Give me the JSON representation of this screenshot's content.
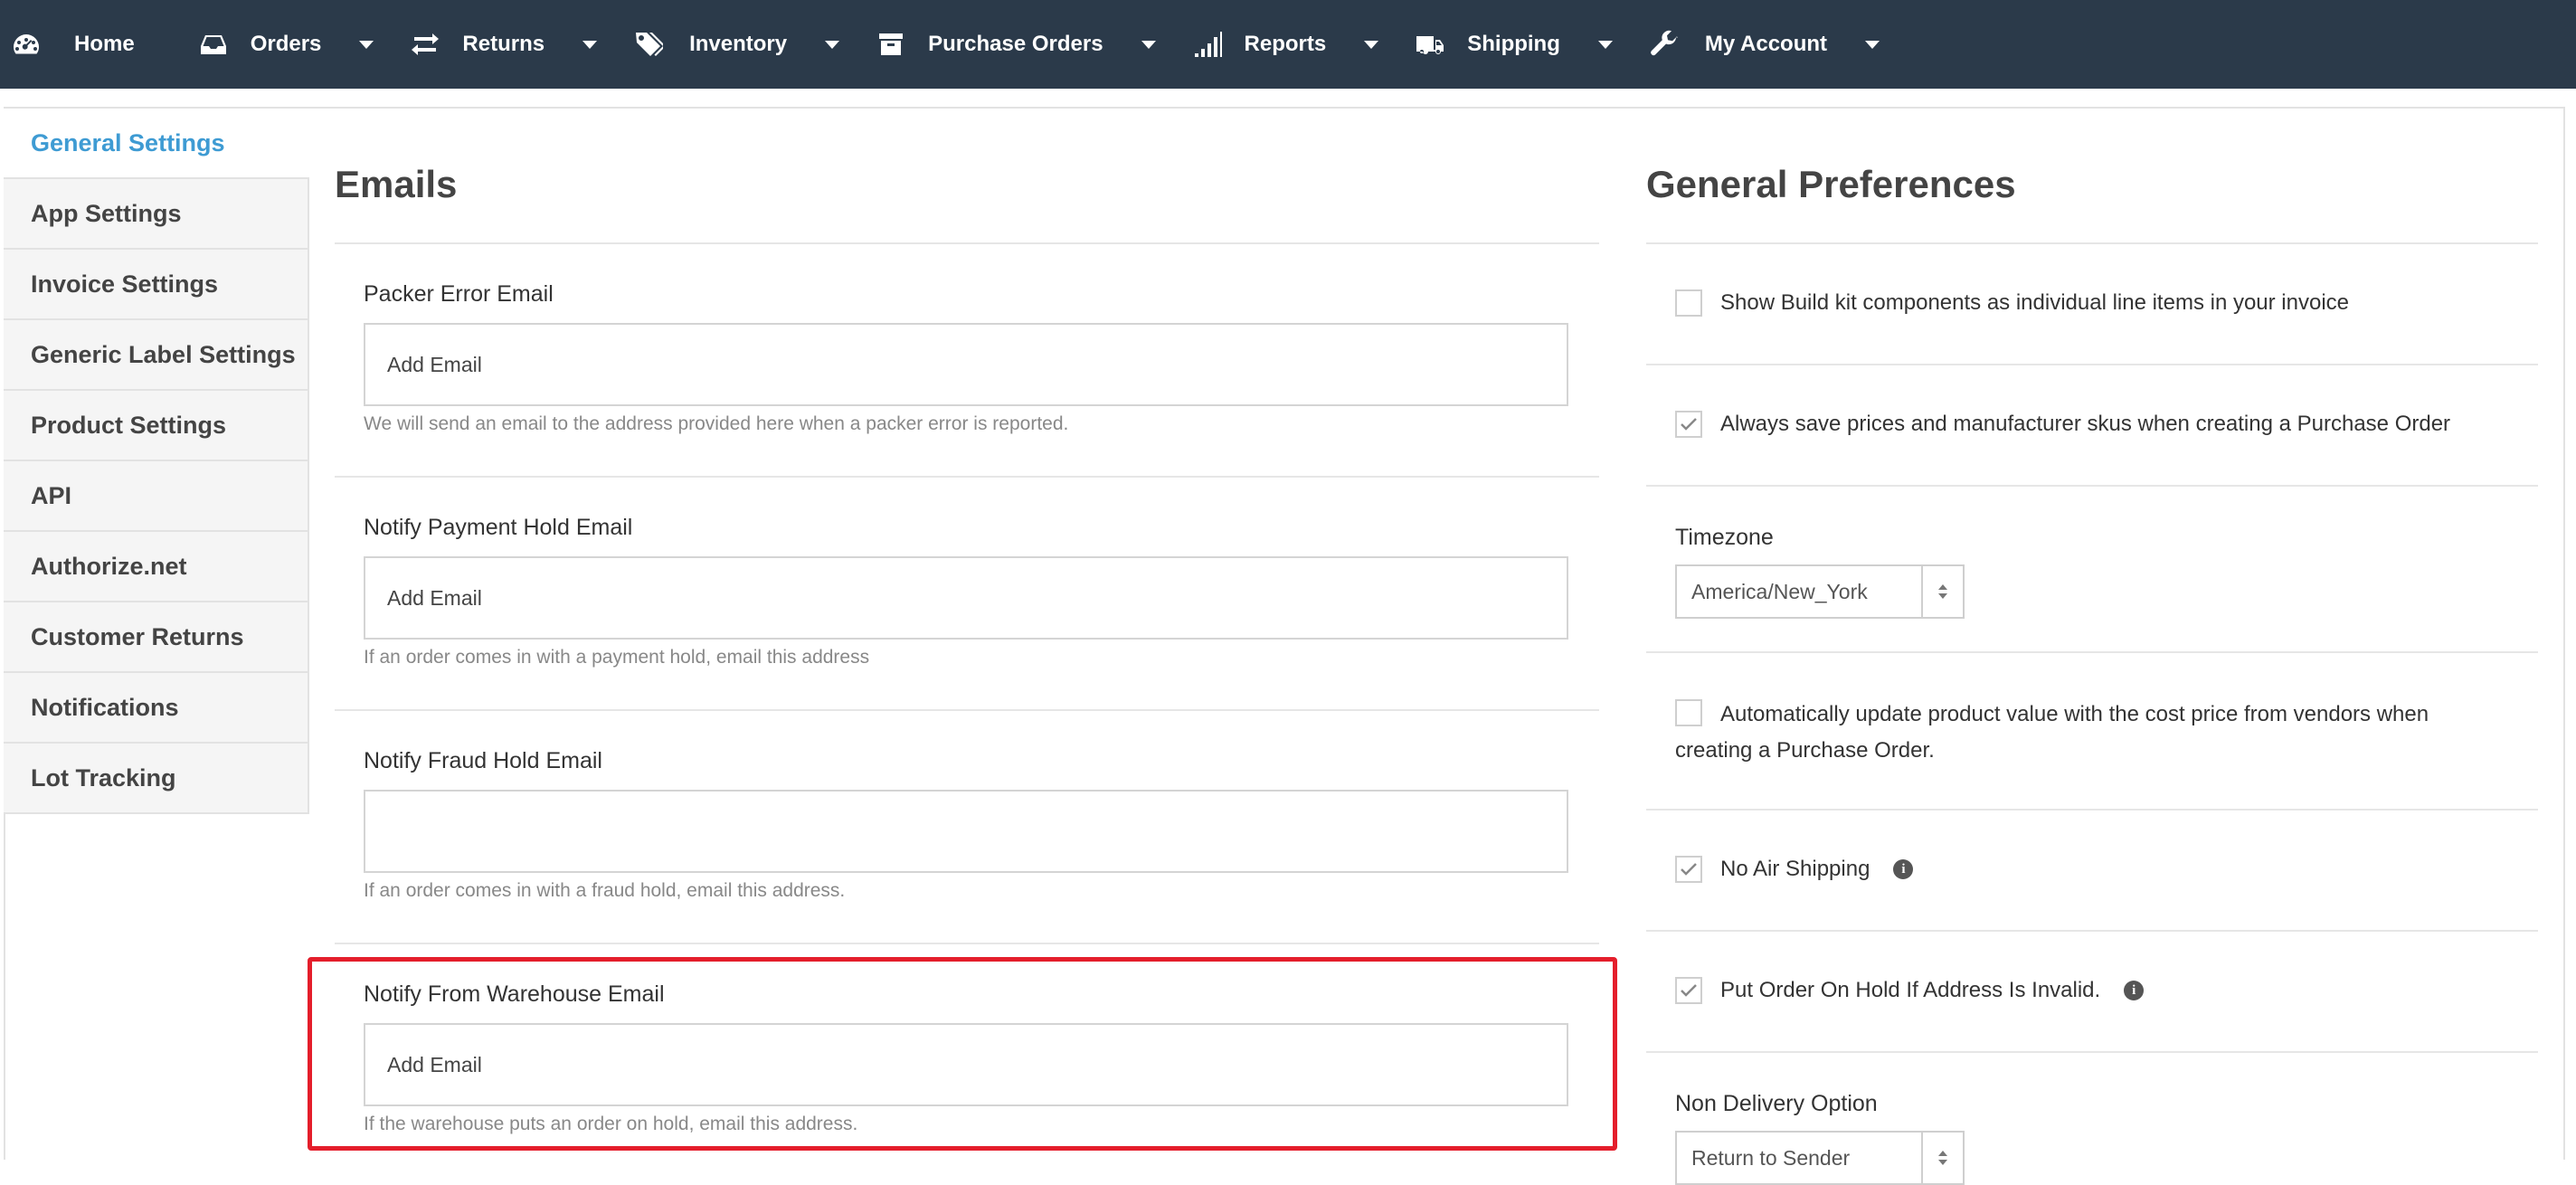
{
  "nav": {
    "items": [
      {
        "label": "Home",
        "icon": "dashboard-icon",
        "has_caret": false
      },
      {
        "label": "Orders",
        "icon": "inbox-icon",
        "has_caret": true
      },
      {
        "label": "Returns",
        "icon": "exchange-icon",
        "has_caret": true
      },
      {
        "label": "Inventory",
        "icon": "tags-icon",
        "has_caret": true
      },
      {
        "label": "Purchase Orders",
        "icon": "archive-icon",
        "has_caret": true
      },
      {
        "label": "Reports",
        "icon": "signal-icon",
        "has_caret": true
      },
      {
        "label": "Shipping",
        "icon": "truck-icon",
        "has_caret": true
      },
      {
        "label": "My Account",
        "icon": "wrench-icon",
        "has_caret": true
      }
    ]
  },
  "sidebar": {
    "items": [
      {
        "label": "General Settings",
        "active": true
      },
      {
        "label": "App Settings"
      },
      {
        "label": "Invoice Settings"
      },
      {
        "label": "Generic Label Settings"
      },
      {
        "label": "Product Settings"
      },
      {
        "label": "API"
      },
      {
        "label": "Authorize.net"
      },
      {
        "label": "Customer Returns"
      },
      {
        "label": "Notifications"
      },
      {
        "label": "Lot Tracking"
      }
    ]
  },
  "emails": {
    "title": "Emails",
    "fields": [
      {
        "label": "Packer Error Email",
        "placeholder": "Add Email",
        "value": "",
        "help": "We will send an email to the address provided here when a packer error is reported."
      },
      {
        "label": "Notify Payment Hold Email",
        "placeholder": "Add Email",
        "value": "",
        "help": "If an order comes in with a payment hold, email this address"
      },
      {
        "label": "Notify Fraud Hold Email",
        "placeholder": "",
        "value": "",
        "help": "If an order comes in with a fraud hold, email this address."
      },
      {
        "label": "Notify From Warehouse Email",
        "placeholder": "Add Email",
        "value": "",
        "help": "If the warehouse puts an order on hold, email this address."
      }
    ]
  },
  "preferences": {
    "title": "General Preferences",
    "build_kit": {
      "label": "Show Build kit components as individual line items in your invoice",
      "checked": false
    },
    "save_prices": {
      "label": "Always save prices and manufacturer skus when creating a Purchase Order",
      "checked": true
    },
    "timezone": {
      "label": "Timezone",
      "value": "America/New_York"
    },
    "auto_update": {
      "label": "Automatically update product value with the cost price from vendors when creating a Purchase Order.",
      "checked": false
    },
    "no_air": {
      "label": "No Air Shipping",
      "checked": true,
      "info": "i"
    },
    "hold_invalid": {
      "label": "Put Order On Hold If Address Is Invalid.",
      "checked": true,
      "info": "i"
    },
    "non_delivery": {
      "label": "Non Delivery Option",
      "value": "Return to Sender"
    }
  },
  "colors": {
    "nav_bg": "#2b3a4a",
    "accent": "#3e9bd3",
    "highlight": "#e41e2b"
  }
}
